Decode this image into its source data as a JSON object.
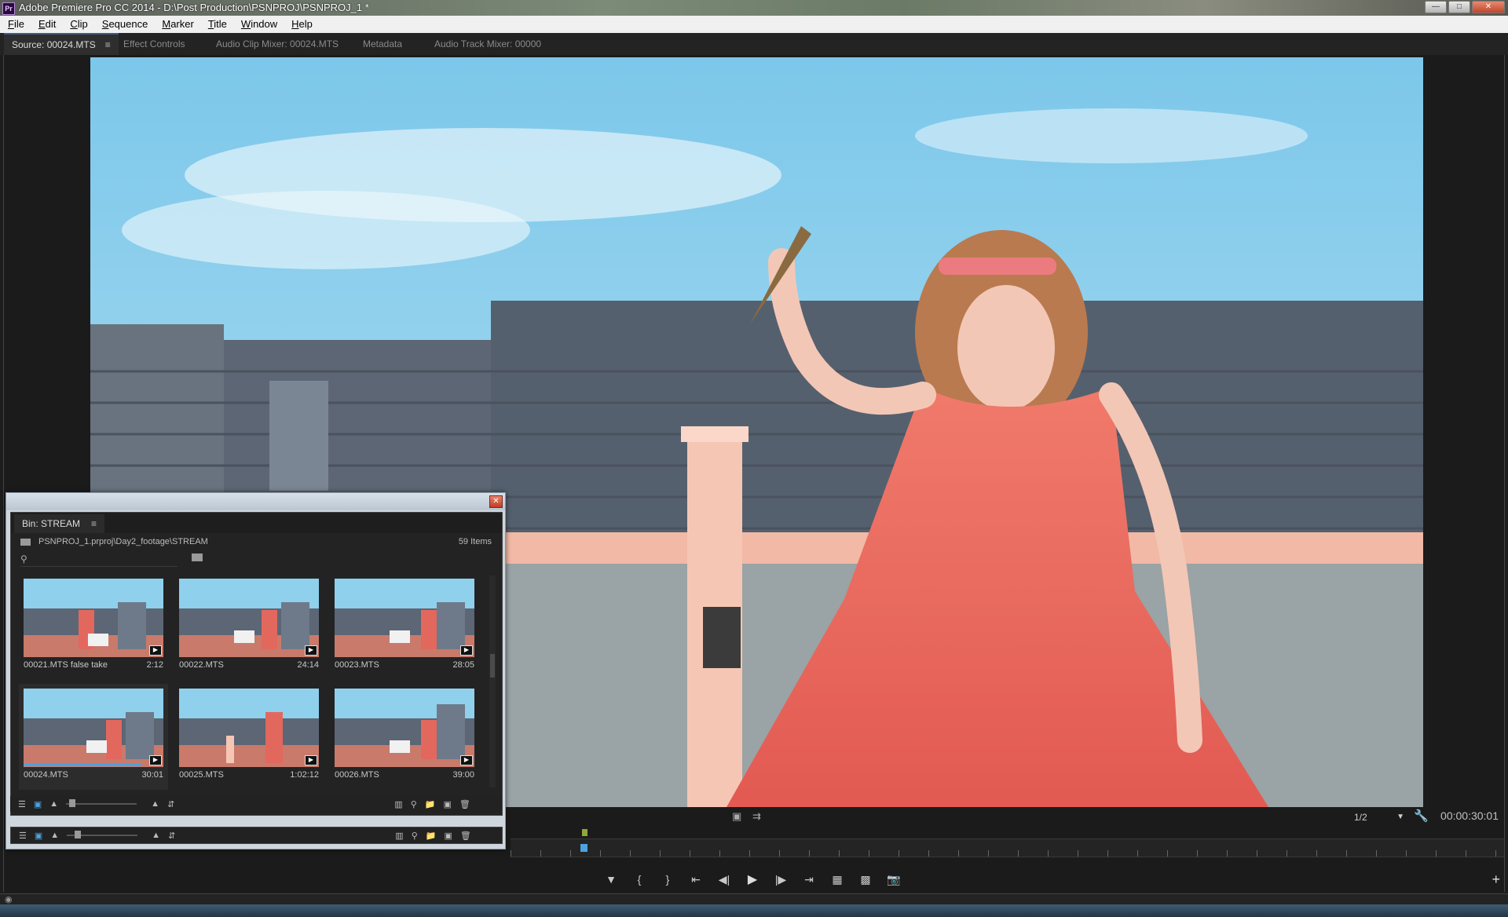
{
  "window": {
    "title": "Adobe Premiere Pro CC 2014 - D:\\Post Production\\PSNPROJ\\PSNPROJ_1 *",
    "app_icon": "Pr"
  },
  "menu": [
    "File",
    "Edit",
    "Clip",
    "Sequence",
    "Marker",
    "Title",
    "Window",
    "Help"
  ],
  "tabs": [
    {
      "label": "Source: 00024.MTS",
      "active": true
    },
    {
      "label": "Effect Controls"
    },
    {
      "label": "Audio Clip Mixer: 00024.MTS"
    },
    {
      "label": "Metadata"
    },
    {
      "label": "Audio Track Mixer: 00000"
    }
  ],
  "monitor": {
    "zoom": "1/2",
    "timecode": "00:00:30:01",
    "playhead_position": 0.07
  },
  "bin": {
    "tab_label": "Bin: STREAM",
    "path": "PSNPROJ_1.prproj\\Day2_footage\\STREAM",
    "item_count": "59 Items",
    "clips": [
      {
        "name": "00021.MTS false take",
        "duration": "2:12"
      },
      {
        "name": "00022.MTS",
        "duration": "24:14"
      },
      {
        "name": "00023.MTS",
        "duration": "28:05"
      },
      {
        "name": "00024.MTS",
        "duration": "30:01",
        "selected": true
      },
      {
        "name": "00025.MTS",
        "duration": "1:02:12"
      },
      {
        "name": "00026.MTS",
        "duration": "39:00"
      }
    ]
  },
  "colors": {
    "accent": "#4aa3df",
    "panel": "#232323",
    "in_marker": "#8ea83a"
  }
}
